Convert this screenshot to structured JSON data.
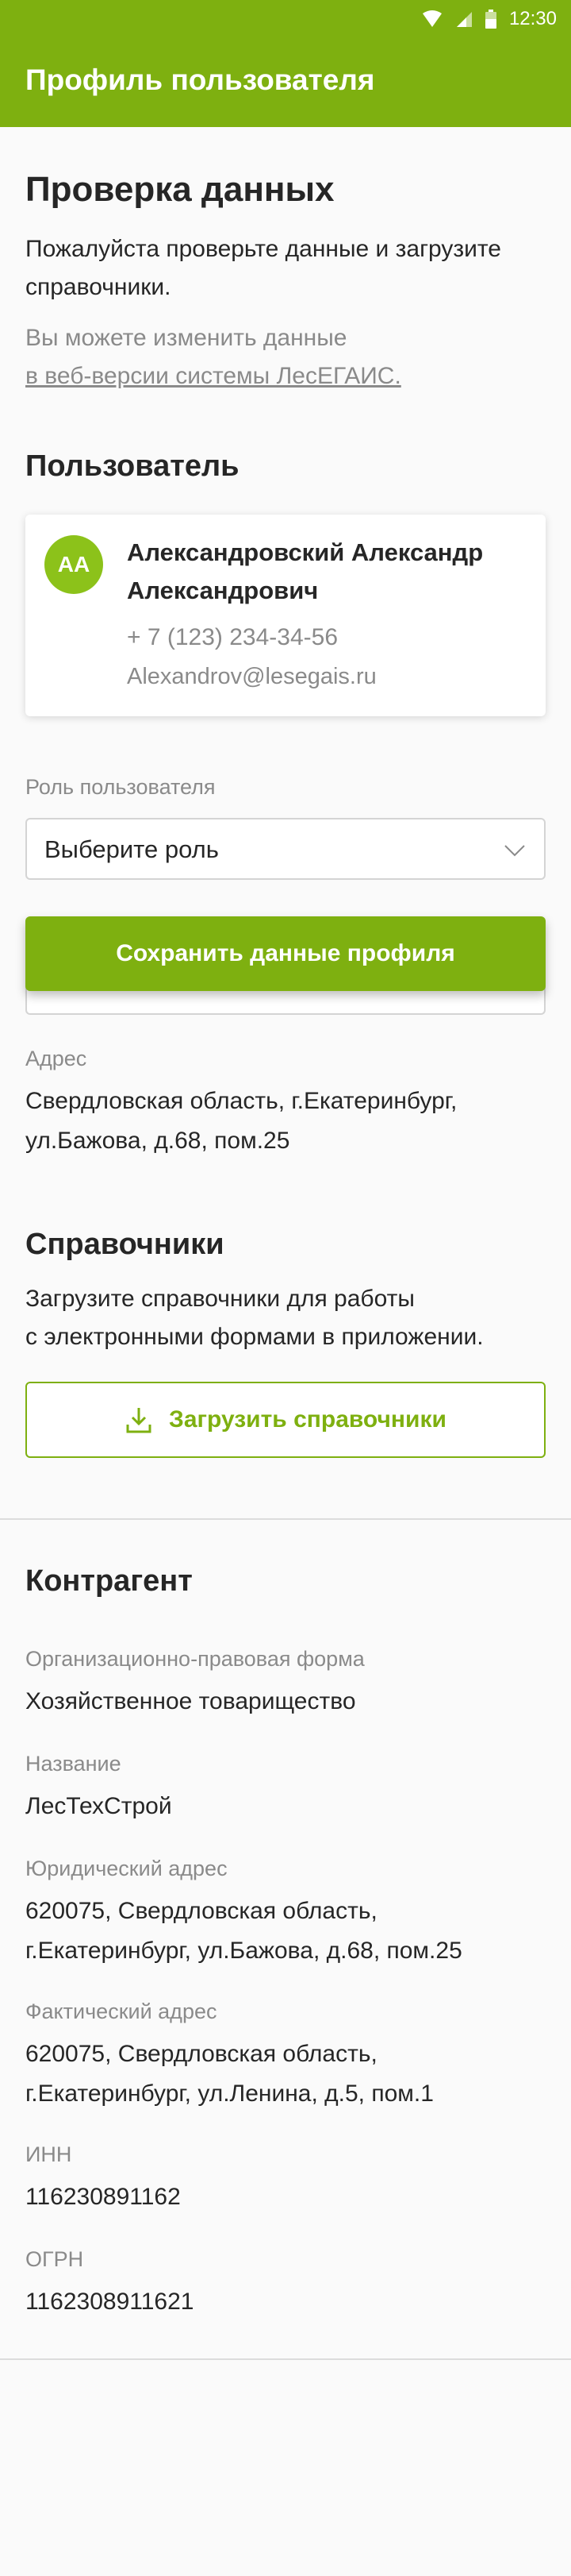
{
  "status_bar": {
    "time": "12:30"
  },
  "app_bar": {
    "title": "Профиль пользователя"
  },
  "check": {
    "title": "Проверка данных",
    "line1": "Пожалуйста проверьте данные и загрузите",
    "line2": "справочники.",
    "hint1": "Вы можете изменить данные",
    "hint_link": "в веб-версии системы ЛесЕГАИС."
  },
  "user": {
    "section_title": "Пользователь",
    "avatar_initials": "AA",
    "name_line1": "Александровский Александр",
    "name_line2": "Александрович",
    "phone": "+ 7 (123) 234-34-56",
    "email": "Alexandrov@lesegais.ru"
  },
  "role": {
    "label": "Роль пользователя",
    "value": "Выберите роль"
  },
  "partial_field_value": "1162308911621",
  "save_button": "Сохранить данные профиля",
  "address": {
    "label": "Адрес",
    "line1": "Свердловская область, г.Екатеринбург,",
    "line2": "ул.Бажова, д.68, пом.25"
  },
  "references": {
    "title": "Справочники",
    "line1": "Загрузите справочники для работы",
    "line2": "с электронными формами в приложении.",
    "button": "Загрузить справочники"
  },
  "counterparty": {
    "title": "Контрагент",
    "org_form_label": "Организационно-правовая форма",
    "org_form_value": "Хозяйственное товарищество",
    "name_label": "Название",
    "name_value": "ЛесТехСтрой",
    "legal_address_label": "Юридический адрес",
    "legal_address_line1": "620075, Свердловская область,",
    "legal_address_line2": "г.Екатеринбург, ул.Бажова, д.68, пом.25",
    "actual_address_label": "Фактический адрес",
    "actual_address_line1": "620075, Свердловская область,",
    "actual_address_line2": "г.Екатеринбург, ул.Ленина, д.5, пом.1",
    "inn_label": "ИНН",
    "inn_value": "116230891162",
    "ogrn_label": "ОГРН",
    "ogrn_value": "1162308911621"
  },
  "colors": {
    "accent": "#7eb010",
    "avatar": "#8cc21a",
    "muted": "#8a8a8a"
  }
}
